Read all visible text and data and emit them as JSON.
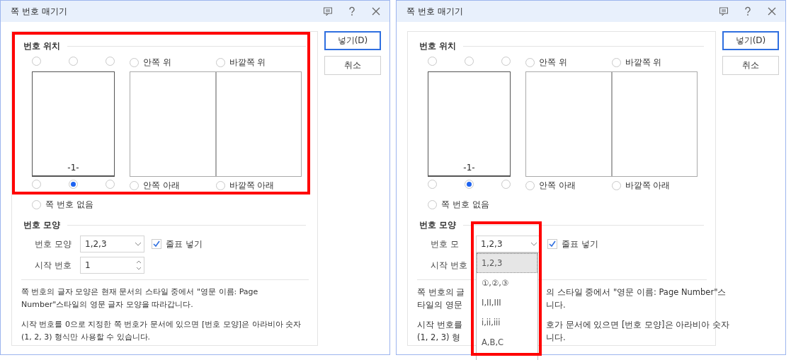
{
  "dialogs": [
    {
      "title": "쪽 번호 매기기",
      "buttons": [
        {
          "label": "넣기(D)",
          "default": true
        },
        {
          "label": "취소",
          "default": false
        }
      ],
      "position": {
        "title": "번호 위치",
        "single_top": [
          {
            "selected": false
          },
          {
            "selected": false
          },
          {
            "selected": false
          }
        ],
        "page_number": "-1-",
        "single_bottom": [
          {
            "selected": false
          },
          {
            "selected": true
          },
          {
            "selected": false
          }
        ],
        "facing_top": [
          {
            "label": "안쪽 위",
            "selected": false
          },
          {
            "label": "바깥쪽 위",
            "selected": false
          }
        ],
        "facing_bottom": [
          {
            "label": "안쪽 아래",
            "selected": false
          },
          {
            "label": "바깥쪽 아래",
            "selected": false
          }
        ],
        "none": {
          "label": "쪽 번호 없음",
          "selected": false
        }
      },
      "format": {
        "title": "번호 모양",
        "format_label": "번호 모양",
        "format_value": "1,2,3",
        "quotes": {
          "label": "줄표 넣기",
          "checked": true
        },
        "start_label": "시작 번호",
        "start_value": "1"
      },
      "position_highlighted": true,
      "notes": [
        "쪽 번호의 글자 모양은 현재 문서의 스타일 중에서 \"영문 이름: Page Number\"스타일의 영문 글자 모양을 따라갑니다.",
        "시작 번호를 0으로 지정한 쪽 번호가 문서에 있으면 [번호 모양]은 아라비아 숫자 (1, 2, 3) 형식만 사용할 수 있습니다."
      ]
    },
    {
      "title": "쪽 번호 매기기",
      "buttons": [
        {
          "label": "넣기(D)",
          "default": true
        },
        {
          "label": "취소",
          "default": false
        }
      ],
      "position": {
        "title": "번호 위치",
        "single_top": [
          {
            "selected": false
          },
          {
            "selected": false
          },
          {
            "selected": false
          }
        ],
        "page_number": "-1-",
        "single_bottom": [
          {
            "selected": false
          },
          {
            "selected": true
          },
          {
            "selected": false
          }
        ],
        "facing_top": [
          {
            "label": "안쪽 위",
            "selected": false
          },
          {
            "label": "바깥쪽 위",
            "selected": false
          }
        ],
        "facing_bottom": [
          {
            "label": "안쪽 아래",
            "selected": false
          },
          {
            "label": "바깥쪽 아래",
            "selected": false
          }
        ],
        "none": {
          "label": "쪽 번호 없음",
          "selected": false
        }
      },
      "format": {
        "title": "번호 모양",
        "highlighted": true,
        "format_label": "번호 모",
        "format_value": "1,2,3",
        "quotes": {
          "label": "줄표 넣기",
          "checked": true
        },
        "start_label": "시작 번호",
        "dropdown": [
          {
            "label": "1,2,3",
            "selected": true
          },
          {
            "label": "①,②,③",
            "selected": false
          },
          {
            "label": "I,II,III",
            "selected": false
          },
          {
            "label": "i,ii,iii",
            "selected": false
          },
          {
            "label": "A,B,C",
            "selected": false
          }
        ]
      },
      "note_fragments": [
        [
          {
            "left": "쪽 번호의 글",
            "right": "의 스타일 중에서 \"영문 이름: Page Number\"스"
          },
          {
            "left": "타일의 영문",
            "right": "니다."
          }
        ],
        [
          {
            "left": "시작 번호를",
            "right": "호가 문서에 있으면 [번호 모양]은 아라비아 숫자"
          },
          {
            "left": "(1, 2, 3) 형",
            "right": "니다."
          }
        ]
      ]
    }
  ]
}
